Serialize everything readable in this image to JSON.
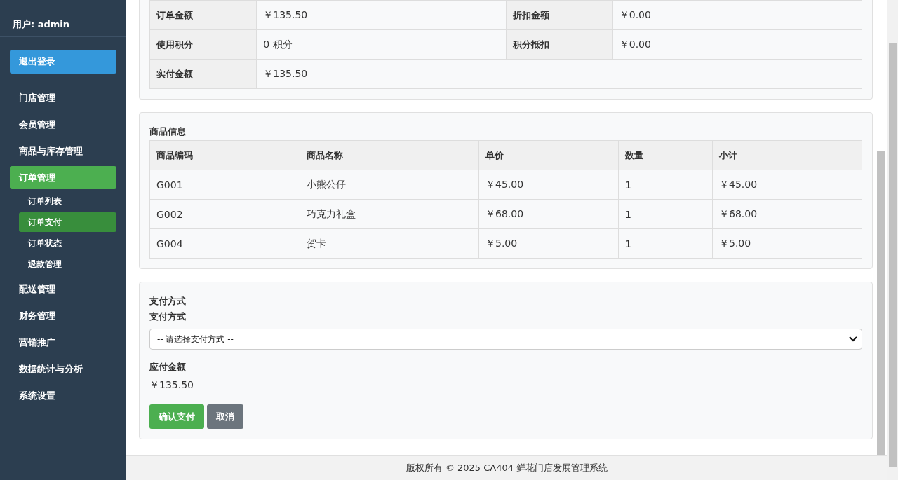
{
  "sidebar": {
    "user": "用户: admin",
    "logout_button": "退出登录",
    "menu": [
      {
        "label": "门店管理",
        "selected": false
      },
      {
        "label": "会员管理",
        "selected": false
      },
      {
        "label": "商品与库存管理",
        "selected": false
      },
      {
        "label": "订单管理",
        "selected": true,
        "children": [
          {
            "label": "订单列表",
            "selected": false
          },
          {
            "label": "订单支付",
            "selected": true
          },
          {
            "label": "订单状态",
            "selected": false
          },
          {
            "label": "退款管理",
            "selected": false
          }
        ]
      },
      {
        "label": "配送管理",
        "selected": false
      },
      {
        "label": "财务管理",
        "selected": false
      },
      {
        "label": "营销推广",
        "selected": false
      },
      {
        "label": "数据统计与分析",
        "selected": false
      },
      {
        "label": "系统设置",
        "selected": false
      }
    ]
  },
  "order_summary": {
    "rows": [
      [
        {
          "label": "订单金额",
          "value": "￥135.50"
        },
        {
          "label": "折扣金额",
          "value": "￥0.00"
        }
      ],
      [
        {
          "label": "使用积分",
          "value": "0 积分"
        },
        {
          "label": "积分抵扣",
          "value": "￥0.00"
        }
      ],
      [
        {
          "label": "实付金额",
          "value": "￥135.50"
        }
      ]
    ]
  },
  "products": {
    "title": "商品信息",
    "columns": [
      "商品编码",
      "商品名称",
      "单价",
      "数量",
      "小计"
    ],
    "rows": [
      [
        "G001",
        "小熊公仔",
        "￥45.00",
        "1",
        "￥45.00"
      ],
      [
        "G002",
        "巧克力礼盒",
        "￥68.00",
        "1",
        "￥68.00"
      ],
      [
        "G004",
        "贺卡",
        "￥5.00",
        "1",
        "￥5.00"
      ]
    ]
  },
  "payment": {
    "title": "支付方式",
    "method_label": "支付方式",
    "method_placeholder": "-- 请选择支付方式 --",
    "amount_label": "应付金额",
    "amount": "￥135.50",
    "buttons": [
      {
        "label": "确认支付",
        "kind": "primary"
      },
      {
        "label": "取消",
        "kind": "secondary"
      }
    ]
  },
  "footer": "版权所有 © 2025 CA404 鲜花门店发展管理系统"
}
